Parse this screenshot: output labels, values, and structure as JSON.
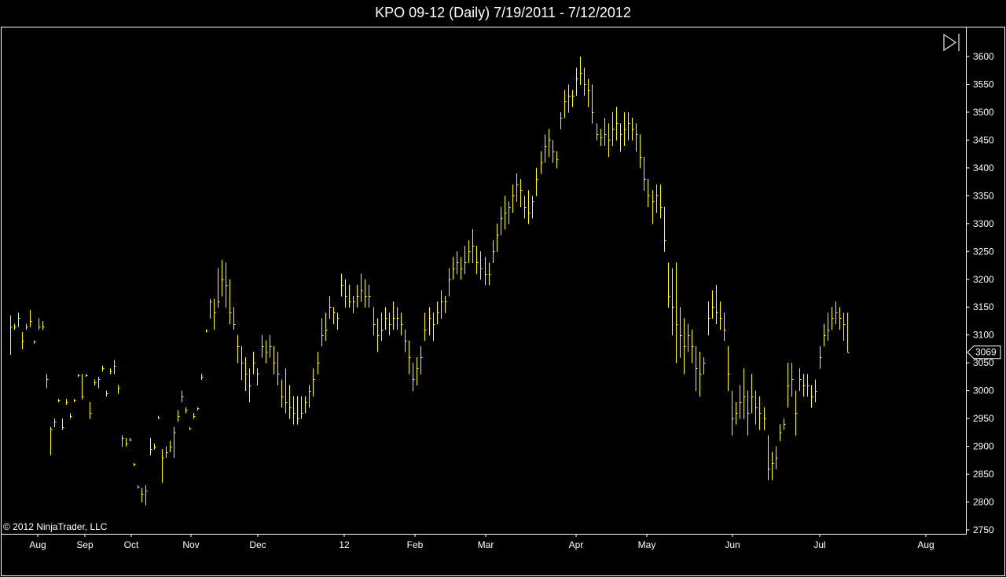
{
  "title": "KPO 09-12 (Daily)  7/19/2011 - 7/12/2012",
  "copyright": "© 2012 NinjaTrader, LLC",
  "toolbar_icon": "scroll-to-end-icon",
  "last_price_label": "3069",
  "colors": {
    "background": "#000000",
    "bar": "#ffff00",
    "axis": "#ffffff"
  },
  "chart_data": {
    "type": "ohlc-bar",
    "title": "KPO 09-12 (Daily)  7/19/2011 - 7/12/2012",
    "instrument": "KPO 09-12",
    "interval": "Daily",
    "date_range": "7/19/2011 - 7/12/2012",
    "ylim": [
      2750,
      3625
    ],
    "y_ticks": [
      2750,
      2800,
      2850,
      2900,
      2950,
      3000,
      3050,
      3100,
      3150,
      3200,
      3250,
      3300,
      3350,
      3400,
      3450,
      3500,
      3550,
      3600
    ],
    "x_ticks": [
      "Aug",
      "Sep",
      "Oct",
      "Nov",
      "Dec",
      "12",
      "Feb",
      "Mar",
      "Apr",
      "May",
      "Jun",
      "Jul",
      "Aug"
    ],
    "last_price": 3069,
    "y_axis_side": "right",
    "grid": false,
    "bars": [
      {
        "h": 3135,
        "l": 3065,
        "c": 3115
      },
      {
        "h": 3120,
        "l": 3110,
        "c": 3115
      },
      {
        "h": 3140,
        "l": 3115,
        "c": 3130
      },
      {
        "h": 3105,
        "l": 3075,
        "c": 3090
      },
      {
        "h": 3120,
        "l": 3110,
        "c": 3115
      },
      {
        "h": 3145,
        "l": 3115,
        "c": 3125
      },
      {
        "h": 3090,
        "l": 3085,
        "c": 3088
      },
      {
        "h": 3130,
        "l": 3110,
        "c": 3115
      },
      {
        "h": 3125,
        "l": 3110,
        "c": 3115
      },
      {
        "h": 3030,
        "l": 3005,
        "c": 3020
      },
      {
        "h": 2935,
        "l": 2885,
        "c": 2930
      },
      {
        "h": 2950,
        "l": 2935,
        "c": 2945
      },
      {
        "h": 2985,
        "l": 2980,
        "c": 2983
      },
      {
        "h": 2950,
        "l": 2930,
        "c": 2935
      },
      {
        "h": 2985,
        "l": 2975,
        "c": 2980
      },
      {
        "h": 2960,
        "l": 2950,
        "c": 2955
      },
      {
        "h": 2985,
        "l": 2980,
        "c": 2982
      },
      {
        "h": 3030,
        "l": 3025,
        "c": 3028
      },
      {
        "h": 3030,
        "l": 2985,
        "c": 2990
      },
      {
        "h": 3030,
        "l": 3025,
        "c": 3028
      },
      {
        "h": 2980,
        "l": 2950,
        "c": 2960
      },
      {
        "h": 3020,
        "l": 3010,
        "c": 3015
      },
      {
        "h": 3025,
        "l": 3005,
        "c": 3020
      },
      {
        "h": 3045,
        "l": 3035,
        "c": 3040
      },
      {
        "h": 3000,
        "l": 2990,
        "c": 2995
      },
      {
        "h": 3040,
        "l": 3030,
        "c": 3035
      },
      {
        "h": 3055,
        "l": 3030,
        "c": 3045
      },
      {
        "h": 3010,
        "l": 2995,
        "c": 3005
      },
      {
        "h": 2920,
        "l": 2900,
        "c": 2915
      },
      {
        "h": 2915,
        "l": 2900,
        "c": 2905
      },
      {
        "h": 2915,
        "l": 2910,
        "c": 2912
      },
      {
        "h": 2870,
        "l": 2865,
        "c": 2868
      },
      {
        "h": 2830,
        "l": 2825,
        "c": 2828
      },
      {
        "h": 2825,
        "l": 2800,
        "c": 2815
      },
      {
        "h": 2830,
        "l": 2795,
        "c": 2820
      },
      {
        "h": 2915,
        "l": 2885,
        "c": 2895
      },
      {
        "h": 2905,
        "l": 2895,
        "c": 2900
      },
      {
        "h": 2955,
        "l": 2950,
        "c": 2952
      },
      {
        "h": 2895,
        "l": 2835,
        "c": 2880
      },
      {
        "h": 2900,
        "l": 2880,
        "c": 2890
      },
      {
        "h": 2910,
        "l": 2890,
        "c": 2900
      },
      {
        "h": 2935,
        "l": 2880,
        "c": 2925
      },
      {
        "h": 2965,
        "l": 2945,
        "c": 2955
      },
      {
        "h": 3000,
        "l": 2980,
        "c": 2990
      },
      {
        "h": 2970,
        "l": 2960,
        "c": 2965
      },
      {
        "h": 2935,
        "l": 2930,
        "c": 2932
      },
      {
        "h": 2960,
        "l": 2950,
        "c": 2955
      },
      {
        "h": 2970,
        "l": 2965,
        "c": 2968
      },
      {
        "h": 3030,
        "l": 3020,
        "c": 3025
      },
      {
        "h": 3110,
        "l": 3105,
        "c": 3108
      },
      {
        "h": 3165,
        "l": 3130,
        "c": 3160
      },
      {
        "h": 3165,
        "l": 3110,
        "c": 3140
      },
      {
        "h": 3220,
        "l": 3150,
        "c": 3160
      },
      {
        "h": 3235,
        "l": 3170,
        "c": 3200
      },
      {
        "h": 3230,
        "l": 3150,
        "c": 3190
      },
      {
        "h": 3200,
        "l": 3120,
        "c": 3140
      },
      {
        "h": 3150,
        "l": 3110,
        "c": 3120
      },
      {
        "h": 3100,
        "l": 3050,
        "c": 3080
      },
      {
        "h": 3080,
        "l": 3020,
        "c": 3050
      },
      {
        "h": 3060,
        "l": 3000,
        "c": 3030
      },
      {
        "h": 3040,
        "l": 2980,
        "c": 3010
      },
      {
        "h": 3070,
        "l": 3030,
        "c": 3050
      },
      {
        "h": 3040,
        "l": 3010,
        "c": 3030
      },
      {
        "h": 3100,
        "l": 3060,
        "c": 3080
      },
      {
        "h": 3090,
        "l": 3050,
        "c": 3070
      },
      {
        "h": 3100,
        "l": 3060,
        "c": 3080
      },
      {
        "h": 3080,
        "l": 3030,
        "c": 3050
      },
      {
        "h": 3070,
        "l": 3010,
        "c": 3030
      },
      {
        "h": 3020,
        "l": 2970,
        "c": 2990
      },
      {
        "h": 3040,
        "l": 2960,
        "c": 2980
      },
      {
        "h": 3010,
        "l": 2950,
        "c": 2970
      },
      {
        "h": 2990,
        "l": 2940,
        "c": 2960
      },
      {
        "h": 2990,
        "l": 2940,
        "c": 2950
      },
      {
        "h": 2990,
        "l": 2950,
        "c": 2960
      },
      {
        "h": 2990,
        "l": 2960,
        "c": 2980
      },
      {
        "h": 3010,
        "l": 2970,
        "c": 3000
      },
      {
        "h": 3040,
        "l": 2990,
        "c": 3020
      },
      {
        "h": 3070,
        "l": 3030,
        "c": 3050
      },
      {
        "h": 3130,
        "l": 3080,
        "c": 3100
      },
      {
        "h": 3140,
        "l": 3090,
        "c": 3110
      },
      {
        "h": 3170,
        "l": 3130,
        "c": 3150
      },
      {
        "h": 3150,
        "l": 3120,
        "c": 3140
      },
      {
        "h": 3140,
        "l": 3110,
        "c": 3130
      },
      {
        "h": 3210,
        "l": 3170,
        "c": 3190
      },
      {
        "h": 3200,
        "l": 3150,
        "c": 3170
      },
      {
        "h": 3190,
        "l": 3150,
        "c": 3160
      },
      {
        "h": 3170,
        "l": 3140,
        "c": 3160
      },
      {
        "h": 3190,
        "l": 3150,
        "c": 3170
      },
      {
        "h": 3210,
        "l": 3160,
        "c": 3180
      },
      {
        "h": 3200,
        "l": 3150,
        "c": 3170
      },
      {
        "h": 3190,
        "l": 3150,
        "c": 3170
      },
      {
        "h": 3150,
        "l": 3100,
        "c": 3120
      },
      {
        "h": 3130,
        "l": 3070,
        "c": 3100
      },
      {
        "h": 3140,
        "l": 3090,
        "c": 3110
      },
      {
        "h": 3150,
        "l": 3110,
        "c": 3130
      },
      {
        "h": 3140,
        "l": 3100,
        "c": 3120
      },
      {
        "h": 3160,
        "l": 3110,
        "c": 3130
      },
      {
        "h": 3150,
        "l": 3110,
        "c": 3130
      },
      {
        "h": 3140,
        "l": 3100,
        "c": 3120
      },
      {
        "h": 3110,
        "l": 3070,
        "c": 3090
      },
      {
        "h": 3090,
        "l": 3030,
        "c": 3060
      },
      {
        "h": 3050,
        "l": 3000,
        "c": 3020
      },
      {
        "h": 3060,
        "l": 3010,
        "c": 3040
      },
      {
        "h": 3080,
        "l": 3030,
        "c": 3060
      },
      {
        "h": 3140,
        "l": 3090,
        "c": 3110
      },
      {
        "h": 3150,
        "l": 3100,
        "c": 3130
      },
      {
        "h": 3140,
        "l": 3090,
        "c": 3120
      },
      {
        "h": 3160,
        "l": 3120,
        "c": 3140
      },
      {
        "h": 3180,
        "l": 3130,
        "c": 3160
      },
      {
        "h": 3170,
        "l": 3140,
        "c": 3160
      },
      {
        "h": 3220,
        "l": 3170,
        "c": 3200
      },
      {
        "h": 3240,
        "l": 3200,
        "c": 3220
      },
      {
        "h": 3250,
        "l": 3210,
        "c": 3230
      },
      {
        "h": 3240,
        "l": 3200,
        "c": 3220
      },
      {
        "h": 3260,
        "l": 3210,
        "c": 3230
      },
      {
        "h": 3270,
        "l": 3230,
        "c": 3250
      },
      {
        "h": 3290,
        "l": 3230,
        "c": 3260
      },
      {
        "h": 3260,
        "l": 3210,
        "c": 3230
      },
      {
        "h": 3250,
        "l": 3200,
        "c": 3220
      },
      {
        "h": 3240,
        "l": 3190,
        "c": 3210
      },
      {
        "h": 3230,
        "l": 3190,
        "c": 3210
      },
      {
        "h": 3270,
        "l": 3230,
        "c": 3250
      },
      {
        "h": 3300,
        "l": 3250,
        "c": 3280
      },
      {
        "h": 3330,
        "l": 3280,
        "c": 3310
      },
      {
        "h": 3350,
        "l": 3290,
        "c": 3320
      },
      {
        "h": 3340,
        "l": 3300,
        "c": 3330
      },
      {
        "h": 3370,
        "l": 3320,
        "c": 3350
      },
      {
        "h": 3390,
        "l": 3340,
        "c": 3370
      },
      {
        "h": 3380,
        "l": 3330,
        "c": 3360
      },
      {
        "h": 3350,
        "l": 3310,
        "c": 3330
      },
      {
        "h": 3360,
        "l": 3300,
        "c": 3320
      },
      {
        "h": 3350,
        "l": 3310,
        "c": 3340
      },
      {
        "h": 3400,
        "l": 3350,
        "c": 3380
      },
      {
        "h": 3430,
        "l": 3390,
        "c": 3410
      },
      {
        "h": 3460,
        "l": 3410,
        "c": 3440
      },
      {
        "h": 3470,
        "l": 3420,
        "c": 3450
      },
      {
        "h": 3450,
        "l": 3410,
        "c": 3430
      },
      {
        "h": 3430,
        "l": 3400,
        "c": 3415
      },
      {
        "h": 3500,
        "l": 3470,
        "c": 3490
      },
      {
        "h": 3540,
        "l": 3490,
        "c": 3520
      },
      {
        "h": 3550,
        "l": 3500,
        "c": 3530
      },
      {
        "h": 3540,
        "l": 3510,
        "c": 3530
      },
      {
        "h": 3580,
        "l": 3530,
        "c": 3560
      },
      {
        "h": 3600,
        "l": 3550,
        "c": 3570
      },
      {
        "h": 3580,
        "l": 3530,
        "c": 3550
      },
      {
        "h": 3560,
        "l": 3510,
        "c": 3540
      },
      {
        "h": 3550,
        "l": 3480,
        "c": 3500
      },
      {
        "h": 3480,
        "l": 3450,
        "c": 3460
      },
      {
        "h": 3470,
        "l": 3440,
        "c": 3455
      },
      {
        "h": 3490,
        "l": 3440,
        "c": 3460
      },
      {
        "h": 3480,
        "l": 3420,
        "c": 3450
      },
      {
        "h": 3500,
        "l": 3440,
        "c": 3470
      },
      {
        "h": 3510,
        "l": 3450,
        "c": 3480
      },
      {
        "h": 3480,
        "l": 3430,
        "c": 3460
      },
      {
        "h": 3500,
        "l": 3440,
        "c": 3470
      },
      {
        "h": 3500,
        "l": 3450,
        "c": 3480
      },
      {
        "h": 3490,
        "l": 3450,
        "c": 3470
      },
      {
        "h": 3480,
        "l": 3430,
        "c": 3460
      },
      {
        "h": 3460,
        "l": 3400,
        "c": 3420
      },
      {
        "h": 3420,
        "l": 3360,
        "c": 3380
      },
      {
        "h": 3380,
        "l": 3330,
        "c": 3350
      },
      {
        "h": 3360,
        "l": 3300,
        "c": 3340
      },
      {
        "h": 3370,
        "l": 3320,
        "c": 3350
      },
      {
        "h": 3370,
        "l": 3310,
        "c": 3330
      },
      {
        "h": 3330,
        "l": 3250,
        "c": 3270
      },
      {
        "h": 3230,
        "l": 3150,
        "c": 3170
      },
      {
        "h": 3220,
        "l": 3100,
        "c": 3150
      },
      {
        "h": 3230,
        "l": 3050,
        "c": 3120
      },
      {
        "h": 3150,
        "l": 3060,
        "c": 3100
      },
      {
        "h": 3130,
        "l": 3030,
        "c": 3080
      },
      {
        "h": 3120,
        "l": 3070,
        "c": 3100
      },
      {
        "h": 3110,
        "l": 3050,
        "c": 3080
      },
      {
        "h": 3080,
        "l": 3000,
        "c": 3040
      },
      {
        "h": 3070,
        "l": 2990,
        "c": 3030
      },
      {
        "h": 3060,
        "l": 3030,
        "c": 3050
      },
      {
        "h": 3160,
        "l": 3100,
        "c": 3130
      },
      {
        "h": 3180,
        "l": 3130,
        "c": 3150
      },
      {
        "h": 3190,
        "l": 3120,
        "c": 3140
      },
      {
        "h": 3160,
        "l": 3110,
        "c": 3130
      },
      {
        "h": 3140,
        "l": 3090,
        "c": 3110
      },
      {
        "h": 3080,
        "l": 3000,
        "c": 3030
      },
      {
        "h": 3000,
        "l": 2920,
        "c": 2950
      },
      {
        "h": 2980,
        "l": 2940,
        "c": 2960
      },
      {
        "h": 3010,
        "l": 2950,
        "c": 2980
      },
      {
        "h": 3040,
        "l": 2950,
        "c": 2990
      },
      {
        "h": 3000,
        "l": 2920,
        "c": 2960
      },
      {
        "h": 3030,
        "l": 2960,
        "c": 2990
      },
      {
        "h": 3000,
        "l": 2940,
        "c": 2970
      },
      {
        "h": 2990,
        "l": 2930,
        "c": 2960
      },
      {
        "h": 2970,
        "l": 2930,
        "c": 2950
      },
      {
        "h": 2920,
        "l": 2840,
        "c": 2860
      },
      {
        "h": 2890,
        "l": 2840,
        "c": 2870
      },
      {
        "h": 2900,
        "l": 2860,
        "c": 2880
      },
      {
        "h": 2940,
        "l": 2910,
        "c": 2925
      },
      {
        "h": 2950,
        "l": 2930,
        "c": 2940
      },
      {
        "h": 3050,
        "l": 2970,
        "c": 3010
      },
      {
        "h": 3050,
        "l": 2990,
        "c": 3020
      },
      {
        "h": 3000,
        "l": 2920,
        "c": 2960
      },
      {
        "h": 3040,
        "l": 3000,
        "c": 3020
      },
      {
        "h": 3030,
        "l": 2990,
        "c": 3010
      },
      {
        "h": 3030,
        "l": 2990,
        "c": 3010
      },
      {
        "h": 3010,
        "l": 2970,
        "c": 2990
      },
      {
        "h": 3020,
        "l": 2980,
        "c": 3000
      },
      {
        "h": 3080,
        "l": 3040,
        "c": 3060
      },
      {
        "h": 3120,
        "l": 3080,
        "c": 3100
      },
      {
        "h": 3140,
        "l": 3090,
        "c": 3110
      },
      {
        "h": 3150,
        "l": 3110,
        "c": 3130
      },
      {
        "h": 3160,
        "l": 3120,
        "c": 3140
      },
      {
        "h": 3150,
        "l": 3110,
        "c": 3130
      },
      {
        "h": 3140,
        "l": 3090,
        "c": 3120
      },
      {
        "h": 3140,
        "l": 3070,
        "c": 3069
      }
    ]
  }
}
